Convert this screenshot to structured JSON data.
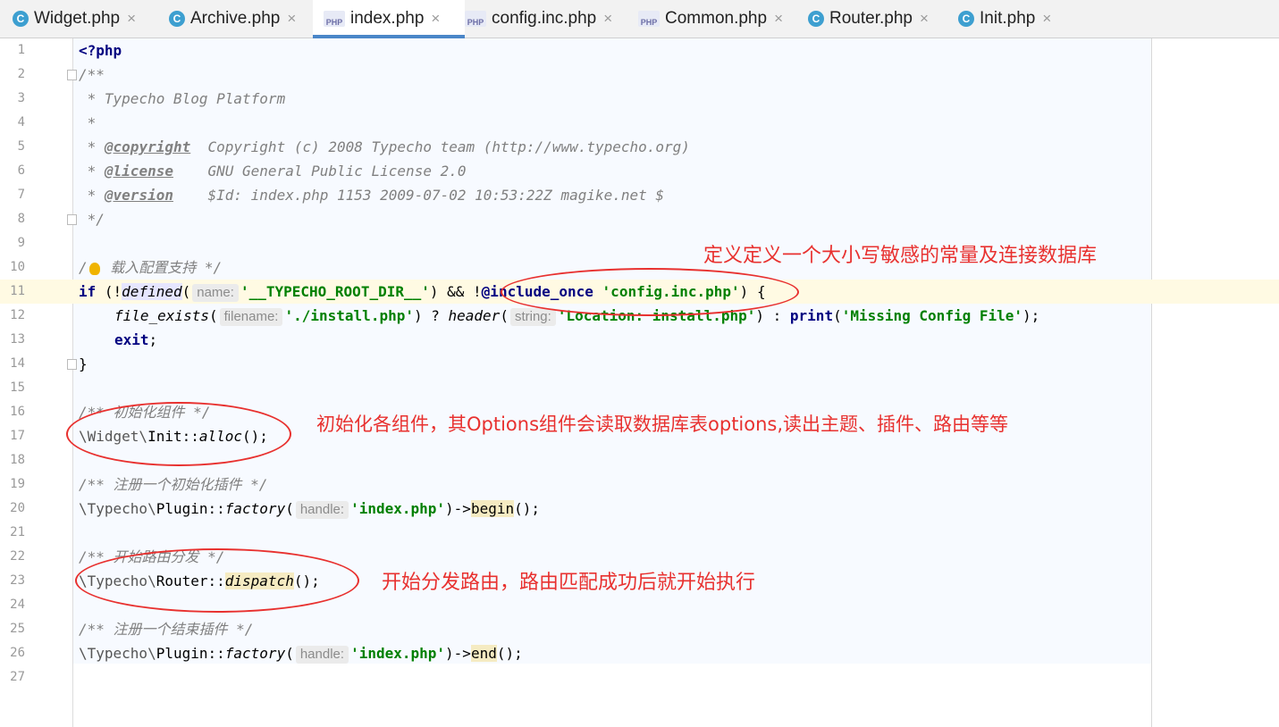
{
  "tabs": [
    {
      "label": "Widget.php",
      "icon": "c"
    },
    {
      "label": "Archive.php",
      "icon": "c"
    },
    {
      "label": "index.php",
      "icon": "php",
      "active": true
    },
    {
      "label": "config.inc.php",
      "icon": "php"
    },
    {
      "label": "Common.php",
      "icon": "php"
    },
    {
      "label": "Router.php",
      "icon": "c"
    },
    {
      "label": "Init.php",
      "icon": "c"
    }
  ],
  "tab_icon_labels": {
    "c": "C",
    "php": "PHP"
  },
  "close_glyph": "×",
  "line_numbers": [
    "1",
    "2",
    "3",
    "4",
    "5",
    "6",
    "7",
    "8",
    "9",
    "10",
    "11",
    "12",
    "13",
    "14",
    "15",
    "16",
    "17",
    "18",
    "19",
    "20",
    "21",
    "22",
    "23",
    "24",
    "25",
    "26",
    "27"
  ],
  "code": {
    "l1": "<?php",
    "l2": "/**",
    "l3a": " * ",
    "l3b": "Typecho Blog Platform",
    "l4": " *",
    "l5a": " * ",
    "l5tag": "@copyright",
    "l5b": "  Copyright (c) 2008 Typecho team (http://www.typecho.org)",
    "l6a": " * ",
    "l6tag": "@license",
    "l6b": "    GNU General Public License 2.0",
    "l7a": " * ",
    "l7tag": "@version",
    "l7b": "    $Id: index.php 1153 2009-07-02 10:53:22Z magike.net $",
    "l8": " */",
    "l10a": "/",
    "l10b": " 载入配置支持 */",
    "l11_if": "if",
    "l11_a": " (!",
    "l11_fn": "defined",
    "l11_p": "(",
    "l11_hint": "name:",
    "l11_str": "'__TYPECHO_ROOT_DIR__'",
    "l11_b": ") && !",
    "l11_inc": "@include_once",
    "l11_str2": "'config.inc.php'",
    "l11_c": ") {",
    "l12_fn": "file_exists",
    "l12_p": "(",
    "l12_hint": "filename:",
    "l12_str": "'./install.php'",
    "l12_b": ") ? ",
    "l12_fn2": "header",
    "l12_p2": "(",
    "l12_hint2": "string:",
    "l12_str2": "'Location: install.php'",
    "l12_c": ") : ",
    "l12_kw": "print",
    "l12_p3": "(",
    "l12_str3": "'Missing Config File'",
    "l12_d": ");",
    "l13": "exit",
    "l13b": ";",
    "l14": "}",
    "l16": "/** 初始化组件 */",
    "l17a": "\\Widget\\",
    "l17b": "Init::",
    "l17fn": "alloc",
    "l17c": "();",
    "l19": "/** 注册一个初始化插件 */",
    "l20a": "\\Typecho\\",
    "l20b": "Plugin::",
    "l20fn": "factory",
    "l20p": "(",
    "l20hint": "handle:",
    "l20str": "'index.php'",
    "l20c": ")->",
    "l20m": "begin",
    "l20d": "();",
    "l22": "/** 开始路由分发 */",
    "l23a": "\\Typecho\\",
    "l23b": "Router::",
    "l23fn": "dispatch",
    "l23c": "();",
    "l25": "/** 注册一个结束插件 */",
    "l26a": "\\Typecho\\",
    "l26b": "Plugin::",
    "l26fn": "factory",
    "l26p": "(",
    "l26hint": "handle:",
    "l26str": "'index.php'",
    "l26c": ")->",
    "l26m": "end",
    "l26d": "();"
  },
  "annotations": {
    "note1": "定义定义一个大小写敏感的常量及连接数据库",
    "note2": "初始化各组件，其Options组件会读取数据库表options,读出主题、插件、路由等等",
    "note3": "开始分发路由，路由匹配成功后就开始执行"
  },
  "colors": {
    "annotation": "#e8312f",
    "keyword": "#000080",
    "string": "#008000",
    "comment": "#808080",
    "current_line": "#fffae3"
  }
}
